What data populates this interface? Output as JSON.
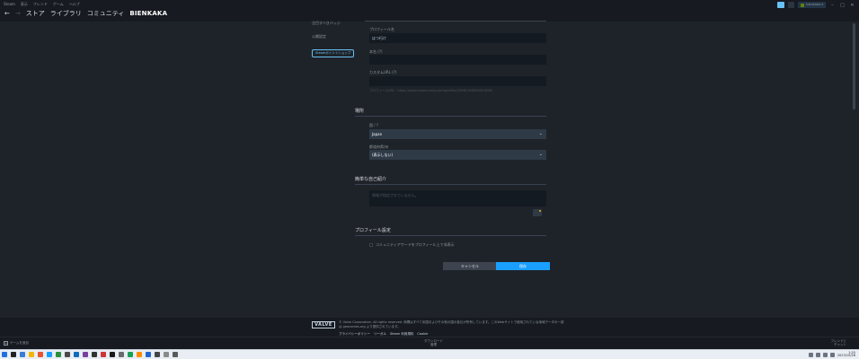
{
  "menubar": {
    "items": [
      "Steam",
      "表示",
      "フレンド",
      "ゲーム",
      "ヘルプ"
    ]
  },
  "nav": {
    "back": "←",
    "forward": "→",
    "tabs": [
      "ストア",
      "ライブラリ",
      "コミュニティ"
    ],
    "username": "BIENKAKA"
  },
  "titlebar": {
    "account_label": "bienkaka ▾",
    "minimize": "–",
    "maximize": "□",
    "close": "✕"
  },
  "sidebar": {
    "featured_badge": "注目すべきバッジ",
    "privacy": "公開設定",
    "points_shop_button": "Steamポイントショップ"
  },
  "form": {
    "profile_name_label": "プロフィール名",
    "profile_name_value": "はつ行け",
    "real_name_label": "本名 (?)",
    "real_name_value": "",
    "custom_url_label": "カスタムURL (?)",
    "custom_url_value": "",
    "profile_url_hint": "プロフィールURL：https://steamcommunity.com/profiles/76561198094601698/",
    "location_title": "場所",
    "country_label": "国 / ?",
    "country_value": "Japan",
    "region_label": "都道府県/州",
    "region_value": "(表示しない)",
    "summary_title": "簡単な自己紹介",
    "summary_placeholder": "情報が指定されていません。",
    "profile_settings_title": "プロフィール設定",
    "community_award_checkbox": "コミュニティアワードをプロフィール上で非表示",
    "cancel_button": "キャンセル",
    "save_button": "保存",
    "chevron": "⌄"
  },
  "footer": {
    "valve_logo": "VALVE",
    "copyright_line1": "© Valve Corporation. All rights reserved. 商標はすべて米国およびその他の国の各社が所有しています。このWebサイトで使用されている地域データの一部",
    "copyright_line2": "は geonames.org より提供されています。",
    "links": [
      "プライバシーポリシー",
      "リーガル",
      "Steam 利用規約",
      "Cookie"
    ]
  },
  "bottombar": {
    "add_game_plus": "+",
    "add_game": "ゲームを追加",
    "downloads_line1": "ダウンロード",
    "downloads_line2": "管理",
    "friends_line1": "フレンドと",
    "friends_line2": "チャット"
  },
  "taskbar": {
    "time": "1:25",
    "date": "2023/10/26",
    "icon_colors": [
      "#1f6fe0",
      "#222222",
      "#3a7bd5",
      "#f2b705",
      "#e8552f",
      "#1a9fff",
      "#2d8f3c",
      "#4a4a4a",
      "#0f6cbd",
      "#7b3fa0",
      "#333333",
      "#d13438",
      "#1a1a1a",
      "#6b6b6b",
      "#18a058",
      "#ff8c00",
      "#2266cc",
      "#444444",
      "#8a8a8a",
      "#5a5a5a"
    ]
  }
}
